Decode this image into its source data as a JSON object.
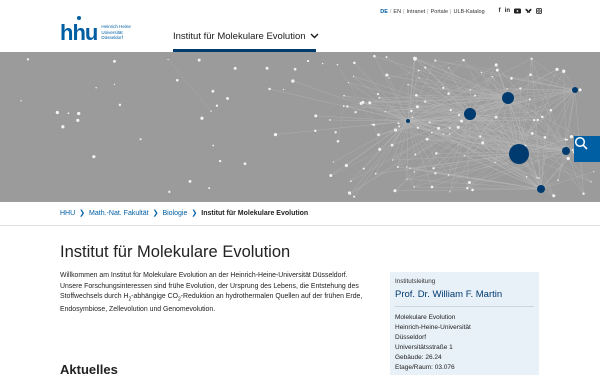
{
  "logo": {
    "word": "hhu",
    "subtitle": [
      "Heinrich Heine",
      "Universität",
      "Düsseldorf"
    ]
  },
  "topnav": {
    "lang_de": "DE",
    "lang_sep": "/",
    "lang_en": "EN",
    "links": [
      "Intranet",
      "Portale",
      "ULB-Katalog"
    ],
    "social_icons": [
      "facebook-icon",
      "linkedin-icon",
      "youtube-icon",
      "bluesky-icon",
      "instagram-icon"
    ]
  },
  "mainnav": {
    "label": "Institut für Molekulare Evolution"
  },
  "breadcrumb": {
    "items": [
      "HHU",
      "Math.-Nat. Fakultät",
      "Biologie"
    ],
    "current": "Institut für Molekulare Evolution"
  },
  "main": {
    "title": "Institut für Molekulare Evolution",
    "intro_part1": "Willkommen am Institut für Molekulare Evolution an der Heinrich-Heine-Universität Düsseldorf. Unsere Forschungsinteressen sind frühe Evolution, der Ursprung des Lebens, die Entstehung des Stoffwechsels durch H",
    "intro_sub1": "2",
    "intro_part2": "-abhängige CO",
    "intro_sub2": "2",
    "intro_part3": "-Reduktion an hydrothermalen Quellen auf der frühen Erde, Endosymbiose, Zellevolution und Genomevolution.",
    "news_heading": "Aktuelles"
  },
  "contact": {
    "role": "Institutsleitung",
    "name": "Prof. Dr. William F. Martin",
    "lines": [
      "Molekulare Evolution",
      "Heinrich-Heine-Universität",
      "Düsseldorf",
      "Universitätsstraße 1",
      "Gebäude: 26.24",
      "Etage/Raum: 03.076"
    ]
  },
  "colors": {
    "brand_blue": "#005ea3",
    "dark_blue": "#003b6f",
    "hero_gray": "#9a9a9a",
    "contact_bg": "#e8f0f8"
  }
}
